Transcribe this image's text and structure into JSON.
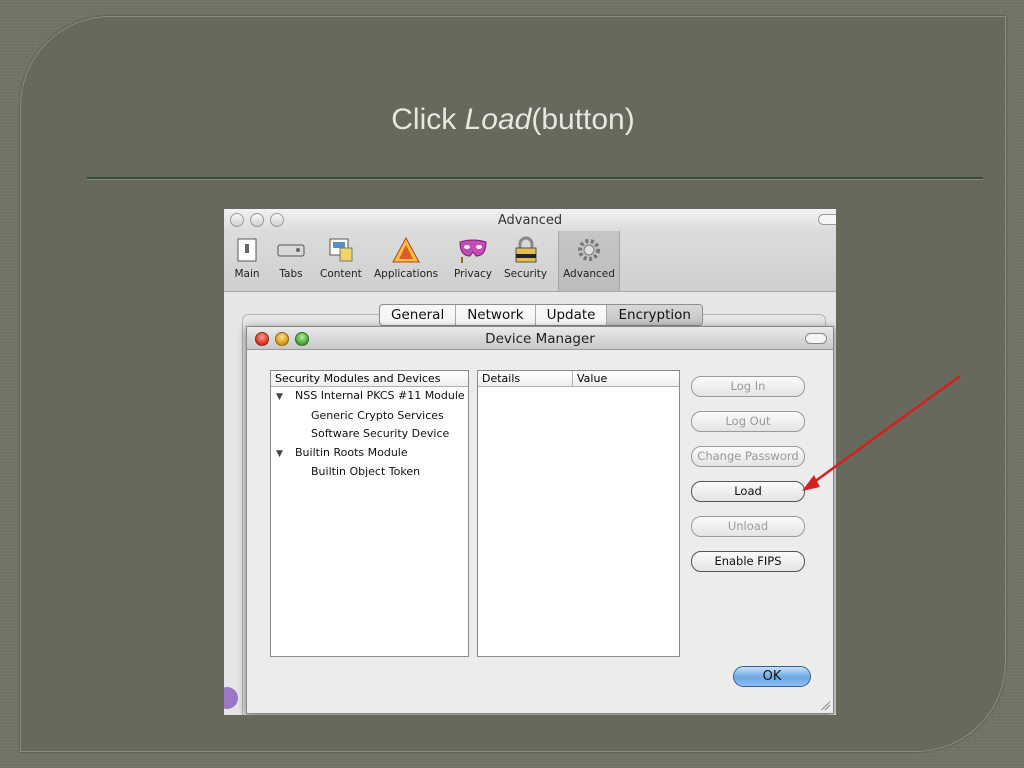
{
  "slide": {
    "title_prefix": "Click ",
    "title_em": "Load",
    "title_suffix": "(button)"
  },
  "advanced_window": {
    "title": "Advanced",
    "toolbar": [
      {
        "label": "Main",
        "icon": "main-switch-icon"
      },
      {
        "label": "Tabs",
        "icon": "tabs-icon"
      },
      {
        "label": "Content",
        "icon": "content-icon"
      },
      {
        "label": "Applications",
        "icon": "applications-icon"
      },
      {
        "label": "Privacy",
        "icon": "privacy-mask-icon"
      },
      {
        "label": "Security",
        "icon": "security-lock-icon"
      },
      {
        "label": "Advanced",
        "icon": "advanced-gear-icon"
      }
    ],
    "selected_toolbar_item": "Advanced",
    "tabs": [
      "General",
      "Network",
      "Update",
      "Encryption"
    ],
    "active_tab": "Encryption"
  },
  "device_manager": {
    "title": "Device Manager",
    "modules_header": "Security Modules and Devices",
    "tree": [
      {
        "label": "NSS Internal PKCS #11 Module",
        "level": 0,
        "expanded": true
      },
      {
        "label": "Generic Crypto Services",
        "level": 1
      },
      {
        "label": "Software Security Device",
        "level": 1
      },
      {
        "label": "Builtin Roots Module",
        "level": 0,
        "expanded": true
      },
      {
        "label": "Builtin Object Token",
        "level": 1
      }
    ],
    "details_header": "Details",
    "value_header": "Value",
    "buttons": {
      "login": "Log In",
      "logout": "Log Out",
      "change_password": "Change Password",
      "load": "Load",
      "unload": "Unload",
      "enable_fips": "Enable FIPS"
    },
    "ok": "OK"
  },
  "colors": {
    "slide_bg": "#66695b",
    "arrow": "#d42020",
    "ok_button": "#6aa7e4"
  }
}
